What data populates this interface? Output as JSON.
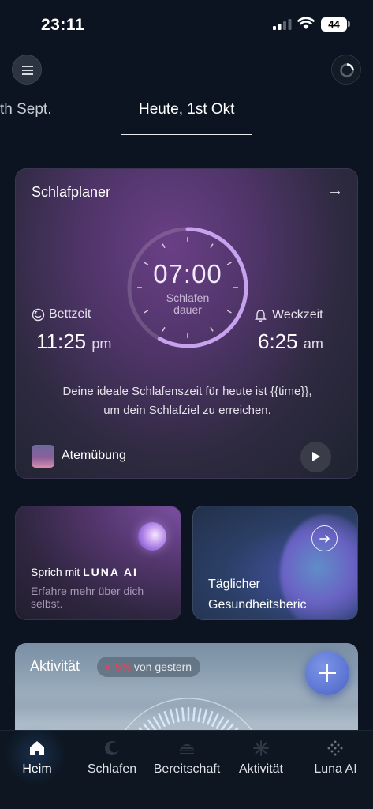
{
  "status_bar": {
    "time": "23:11",
    "battery": "44"
  },
  "header": {
    "date_prev": "th Sept.",
    "date_current": "Heute, 1st Okt"
  },
  "planner": {
    "title": "Schlafplaner",
    "arrow": "→",
    "duration": "07:00",
    "duration_label_line1": "Schlafen",
    "duration_label_line2": "dauer",
    "duration_progress": 0.58,
    "bedtime_label": "Bettzeit",
    "bedtime_value": "11:25",
    "bedtime_ampm": "pm",
    "wake_label": "Weckzeit",
    "wake_value": "6:25",
    "wake_ampm": "am",
    "message_line1": "Deine ideale Schlafenszeit für heute ist {{time}},",
    "message_line2": "um dein Schlafziel zu erreichen.",
    "breathing_label": "Atemübung"
  },
  "luna_card": {
    "title_prefix": "Sprich mit",
    "brand": "LUNA AI",
    "subtitle": "Erfahre mehr über dich selbst."
  },
  "report_card": {
    "title_line1": "Täglicher",
    "title_line2": "Gesundheitsberic"
  },
  "activity": {
    "title": "Aktivität",
    "change_arrow": "▼",
    "change_value": "5%",
    "change_text": "von gestern"
  },
  "tabs": [
    {
      "label": "Heim",
      "icon": "home-icon",
      "active": true
    },
    {
      "label": "Schlafen",
      "icon": "moon-icon",
      "active": false
    },
    {
      "label": "Bereitschaft",
      "icon": "readiness-icon",
      "active": false
    },
    {
      "label": "Aktivität",
      "icon": "activity-icon",
      "active": false
    },
    {
      "label": "Luna AI",
      "icon": "sparkle-icon",
      "active": false
    }
  ],
  "colors": {
    "background": "#0b1420",
    "planner_accent": "#c8a2ee",
    "fab": "#5f78d4",
    "negative": "#e0445a"
  }
}
